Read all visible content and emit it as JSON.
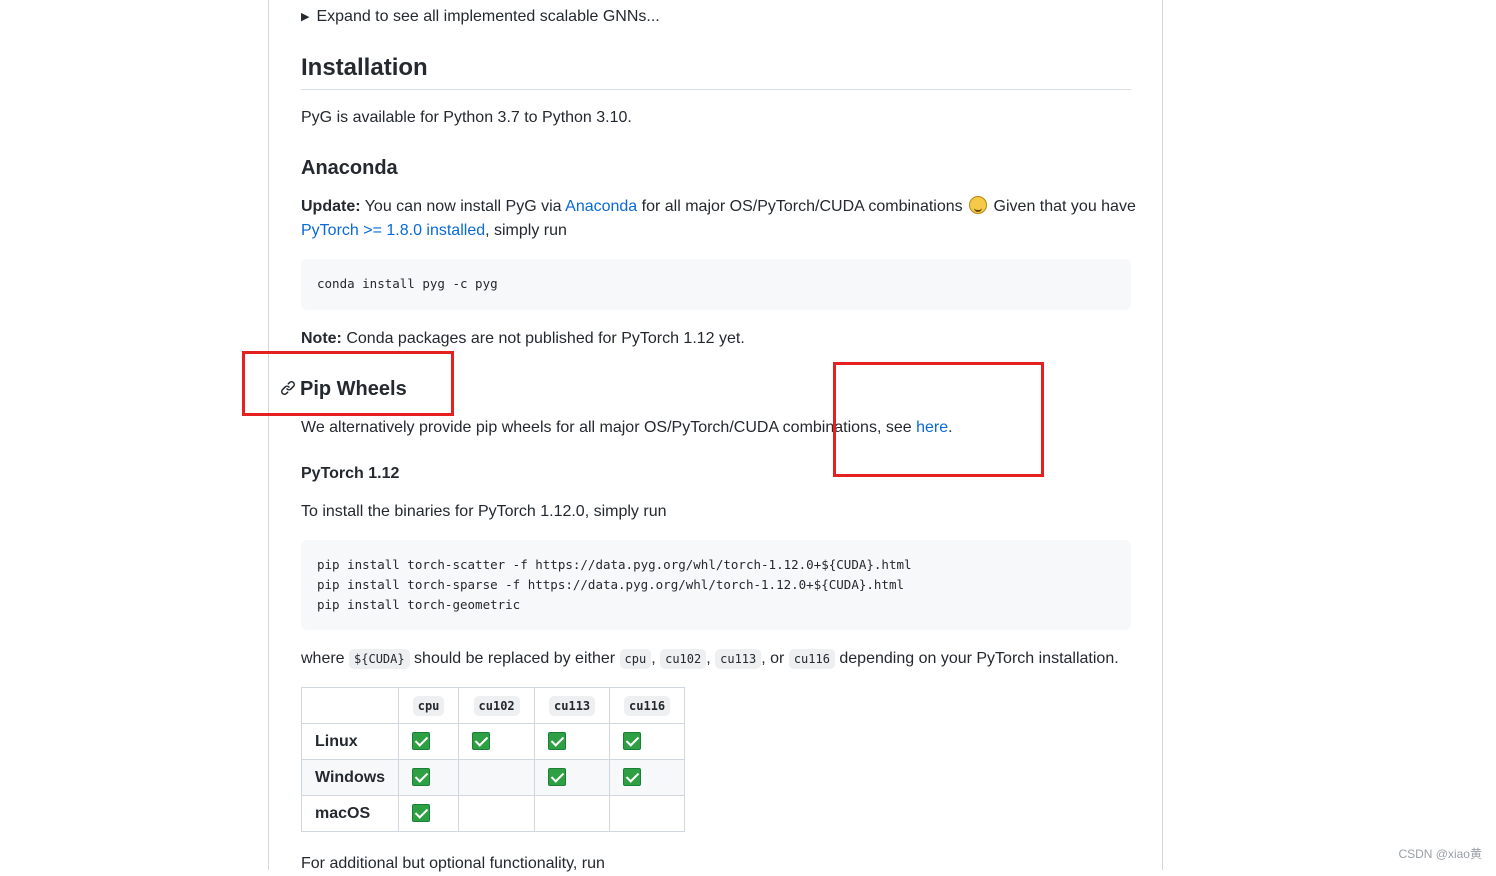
{
  "details_summary": "Expand to see all implemented scalable GNNs...",
  "installation": {
    "heading": "Installation",
    "intro": "PyG is available for Python 3.7 to Python 3.10."
  },
  "anaconda": {
    "heading": "Anaconda",
    "update_label": "Update:",
    "update_text_1": " You can now install PyG via ",
    "anaconda_link": "Anaconda",
    "update_text_2": " for all major OS/PyTorch/CUDA combinations ",
    "update_text_3": " Given that you have",
    "pytorch_link": "PyTorch >= 1.8.0 installed",
    "update_text_4": ", simply run",
    "code": "conda install pyg -c pyg",
    "note_label": "Note:",
    "note_text": " Conda packages are not published for PyTorch 1.12 yet."
  },
  "pip_wheels": {
    "heading": "Pip Wheels",
    "text_before": "We alternatively provide pip wheels for all major OS/PyTorch/CUDA combinations, see ",
    "here_link": "here",
    "text_after": "."
  },
  "pytorch_112": {
    "heading": "PyTorch 1.12",
    "intro": "To install the binaries for PyTorch 1.12.0, simply run",
    "code": "pip install torch-scatter -f https://data.pyg.org/whl/torch-1.12.0+${CUDA}.html\npip install torch-sparse -f https://data.pyg.org/whl/torch-1.12.0+${CUDA}.html\npip install torch-geometric",
    "where_1": "where ",
    "cuda_code": "${CUDA}",
    "where_2": " should be replaced by either ",
    "opt_cpu": "cpu",
    "comma_1": ", ",
    "opt_cu102": "cu102",
    "comma_2": ", ",
    "opt_cu113": "cu113",
    "or_text": ", or ",
    "opt_cu116": "cu116",
    "where_3": " depending on your PyTorch installation."
  },
  "compat_table": {
    "headers": [
      "",
      "cpu",
      "cu102",
      "cu113",
      "cu116"
    ],
    "rows": [
      {
        "os": "Linux",
        "support": [
          true,
          true,
          true,
          true
        ]
      },
      {
        "os": "Windows",
        "support": [
          true,
          false,
          true,
          true
        ]
      },
      {
        "os": "macOS",
        "support": [
          true,
          false,
          false,
          false
        ]
      }
    ]
  },
  "additional_text": "For additional but optional functionality, run",
  "watermark": "CSDN @xiao黄",
  "colors": {
    "link": "#0969da",
    "highlight_box": "#e5211f",
    "check": "#2ea043"
  }
}
